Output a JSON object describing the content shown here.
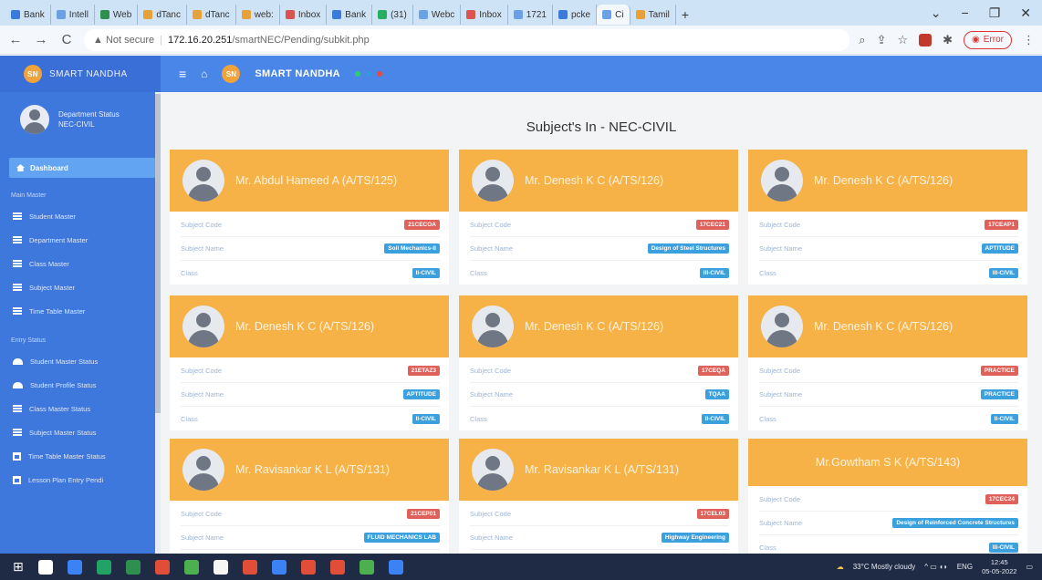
{
  "browser": {
    "tabs": [
      {
        "label": "Bank",
        "color": "#3c7bd9"
      },
      {
        "label": "Intell",
        "color": "#6aa0e6"
      },
      {
        "label": "Web",
        "color": "#2f8f4e"
      },
      {
        "label": "dTanc",
        "color": "#e7a13a"
      },
      {
        "label": "dTanc",
        "color": "#e7a13a"
      },
      {
        "label": "web:",
        "color": "#e7a13a"
      },
      {
        "label": "Inbox",
        "color": "#d9534f"
      },
      {
        "label": "Bank",
        "color": "#3c7bd9"
      },
      {
        "label": "(31) ",
        "color": "#27ae60"
      },
      {
        "label": "Webc",
        "color": "#6aa0e6"
      },
      {
        "label": "Inbox",
        "color": "#d9534f"
      },
      {
        "label": "1721",
        "color": "#6aa0e6"
      },
      {
        "label": "pcke",
        "color": "#3c7bd9"
      },
      {
        "label": "Ci",
        "color": "#6aa0e6"
      },
      {
        "label": "Tamil",
        "color": "#e7a13a"
      }
    ],
    "new_tab": "+",
    "window_controls": {
      "collapse": "⌄",
      "minimize": "−",
      "restore": "❐",
      "close": "✕"
    },
    "nav": {
      "back": "←",
      "forward": "→",
      "reload": "C"
    },
    "security": "▲ Not secure",
    "url_host": "172.16.20.251",
    "url_path": "/smartNEC/Pending/subkit.php",
    "addr_icons": [
      "⌕",
      "⇪",
      "☆"
    ],
    "error_label": "Error"
  },
  "app": {
    "brand": "SMART NANDHA",
    "logo_text": "SN",
    "topnav_title": "SMART NANDHA",
    "topnav_icons": {
      "menu": "≡",
      "home": "⌂"
    },
    "dot_colors": [
      "#2ecc71",
      "#3498db",
      "#e74c3c"
    ]
  },
  "sidebar": {
    "user_line1": "Department Status",
    "user_line2": "NEC-CIVIL",
    "active_item": "Dashboard",
    "section_main": "Main Master",
    "main_items": [
      "Student Master",
      "Department Master",
      "Class Master",
      "Subject Master",
      "Time Table Master"
    ],
    "section_entry": "Entry Status",
    "entry_items": [
      {
        "label": "Student Master Status",
        "icon": "people"
      },
      {
        "label": "Student Profile Status",
        "icon": "people"
      },
      {
        "label": "Class Master Status",
        "icon": "menu"
      },
      {
        "label": "Subject Master Status",
        "icon": "menu"
      },
      {
        "label": "Time Table Master Status",
        "icon": "calendar"
      },
      {
        "label": "Lesson Plan Entry Pendi",
        "icon": "calendar"
      }
    ]
  },
  "main": {
    "title": "Subject's In - NEC-CIVIL",
    "labels": {
      "code": "Subject Code",
      "name": "Subject Name",
      "class": "Class"
    },
    "cards": [
      {
        "faculty": "Mr. Abdul Hameed A (A/TS/125)",
        "code": "21CECOA",
        "name": "Soil Mechanics-II",
        "class": "II-CIVIL"
      },
      {
        "faculty": "Mr. Denesh K C (A/TS/126)",
        "code": "17CEC21",
        "name": "Design of Steel Structures",
        "class": "III-CIVIL"
      },
      {
        "faculty": "Mr. Denesh K C (A/TS/126)",
        "code": "17CEAP1",
        "name": "APTITUDE",
        "class": "III-CIVIL"
      },
      {
        "faculty": "Mr. Denesh K C (A/TS/126)",
        "code": "21ETAZ3",
        "name": "APTITUDE",
        "class": "II-CIVIL"
      },
      {
        "faculty": "Mr. Denesh K C (A/TS/126)",
        "code": "17CEQA",
        "name": "TQAA",
        "class": "II-CIVIL"
      },
      {
        "faculty": "Mr. Denesh K C (A/TS/126)",
        "code": "PRACTICE",
        "name": "PRACTICE",
        "class": "II-CIVIL"
      },
      {
        "faculty": "Mr. Ravisankar K L (A/TS/131)",
        "code": "21CEP01",
        "name": "FLUID MECHANICS LAB",
        "class": ""
      },
      {
        "faculty": "Mr. Ravisankar K L (A/TS/131)",
        "code": "17CEL03",
        "name": "Highway Engineering",
        "class": ""
      },
      {
        "faculty": "Mr.Gowtham S K (A/TS/143)",
        "code": "17CEC24",
        "name": "Design of Reinforced Concrete Structures",
        "class": "III-CIVIL"
      }
    ]
  },
  "taskbar": {
    "app_colors": [
      "#ffffff",
      "#3b82f6",
      "#21a366",
      "#2f8f4e",
      "#e04e39",
      "#4caf50",
      "#f5f5f5",
      "#e04e39",
      "#3b82f6",
      "#e04e39",
      "#e04e39",
      "#4caf50",
      "#3b82f6"
    ],
    "weather": "33°C  Mostly cloudy",
    "tray": "^  ▭  ◖◗  ",
    "lang": "ENG",
    "time": "12:45",
    "date": "05-05-2022"
  }
}
